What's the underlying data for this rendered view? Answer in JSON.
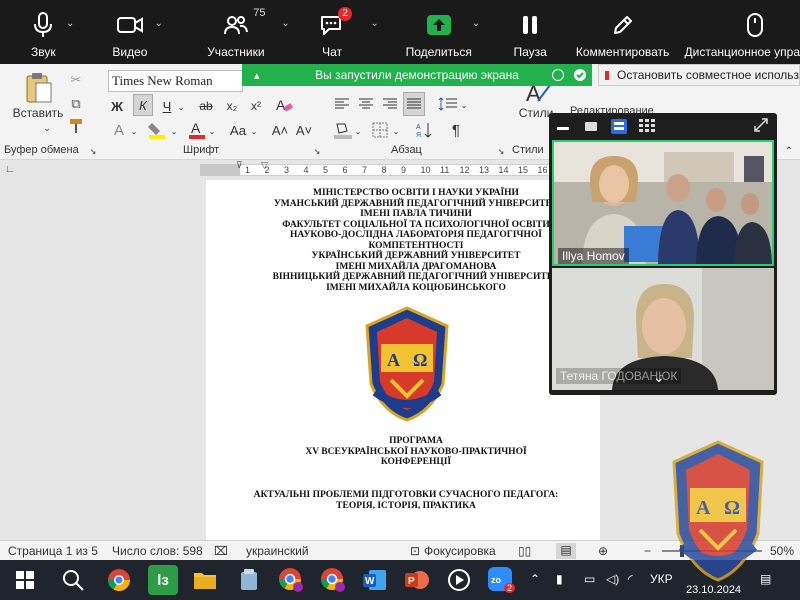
{
  "zoom_toolbar": {
    "audio_label": "Звук",
    "video_label": "Видео",
    "participants_label": "Участники",
    "participants_count": "75",
    "chat_label": "Чат",
    "chat_badge": "2",
    "share_label": "Поделиться",
    "pause_label": "Пауза",
    "annotate_label": "Комментировать",
    "remote_label": "Дистанционное управ"
  },
  "share_banner": {
    "text": "Вы запустили демонстрацию экрана",
    "stop_text": "Остановить совместное использ"
  },
  "ribbon": {
    "font_name": "Times New Roman",
    "paste_label": "Вставить",
    "clipboard_group": "Буфер обмена",
    "font_group": "Шрифт",
    "paragraph_group": "Абзац",
    "styles_group": "Стили",
    "styles_label": "Стили",
    "editing_label": "Редактирование",
    "bold": "Ж",
    "italic": "К",
    "underline": "Ч",
    "strike": "ab",
    "subscript": "x₂",
    "superscript": "x²",
    "case": "Aa",
    "grow": "A˄",
    "shrink": "A˅",
    "pilcrow": "¶"
  },
  "ruler": {
    "marks": [
      "2",
      "1",
      "1",
      "2",
      "3",
      "4",
      "5",
      "6",
      "7",
      "8",
      "9",
      "10",
      "11",
      "12",
      "13",
      "14",
      "15",
      "16",
      "17"
    ]
  },
  "document": {
    "header_lines": [
      "МІНІСТЕРСТВО ОСВІТИ І НАУКИ УКРАЇНИ",
      "УМАНСЬКИЙ ДЕРЖАВНИЙ ПЕДАГОГІЧНИЙ УНІВЕРСИТЕТ",
      "ІМЕНІ ПАВЛА ТИЧИНИ",
      "ФАКУЛЬТЕТ СОЦІАЛЬНОЇ ТА ПСИХОЛОГІЧНОЇ ОСВІТИ",
      "НАУКОВО-ДОСЛІДНА ЛАБОРАТОРІЯ ПЕДАГОГІЧНОЇ",
      "КОМПЕТЕНТНОСТІ",
      "УКРАЇНСЬКИЙ ДЕРЖАВНИЙ УНІВЕРСИТЕТ",
      "ІМЕНІ МИХАЙЛА ДРАГОМАНОВА",
      "ВІННИЦЬКИЙ ДЕРЖАВНИЙ ПЕДАГОГІЧНИЙ УНІВЕРСИТЕТ",
      "ІМЕНІ МИХАЙЛА КОЦЮБИНСЬКОГО"
    ],
    "program_lines": [
      "ПРОГРАМА",
      "XV ВСЕУКРАЇНСЬКОЇ НАУКОВО-ПРАКТИЧНОЇ",
      "КОНФЕРЕНЦІЇ"
    ],
    "topic_lines": [
      "АКТУАЛЬНІ ПРОБЛЕМИ ПІДГОТОВКИ СУЧАСНОГО ПЕДАГОГА:",
      "ТЕОРІЯ, ІСТОРІЯ, ПРАКТИКА"
    ],
    "logo_letters": [
      "А",
      "Ω"
    ]
  },
  "status_bar": {
    "page": "Страница 1 из 5",
    "words": "Число слов: 598",
    "language": "украинский",
    "focus": "Фокусировка",
    "zoom": "50%"
  },
  "video_panel": {
    "participant_1": "Illya Homov",
    "participant_2": "Тетяна ГОДОВАНЮК"
  },
  "taskbar": {
    "language": "УКР",
    "date": "23.10.2024",
    "zoom_badge": "2"
  },
  "colors": {
    "zoom_bar": "#1a1a1a",
    "share_green": "#22b14c",
    "active_speaker": "#2ecc71",
    "stop_red": "#e02b2b",
    "taskbar": "#20242c"
  }
}
